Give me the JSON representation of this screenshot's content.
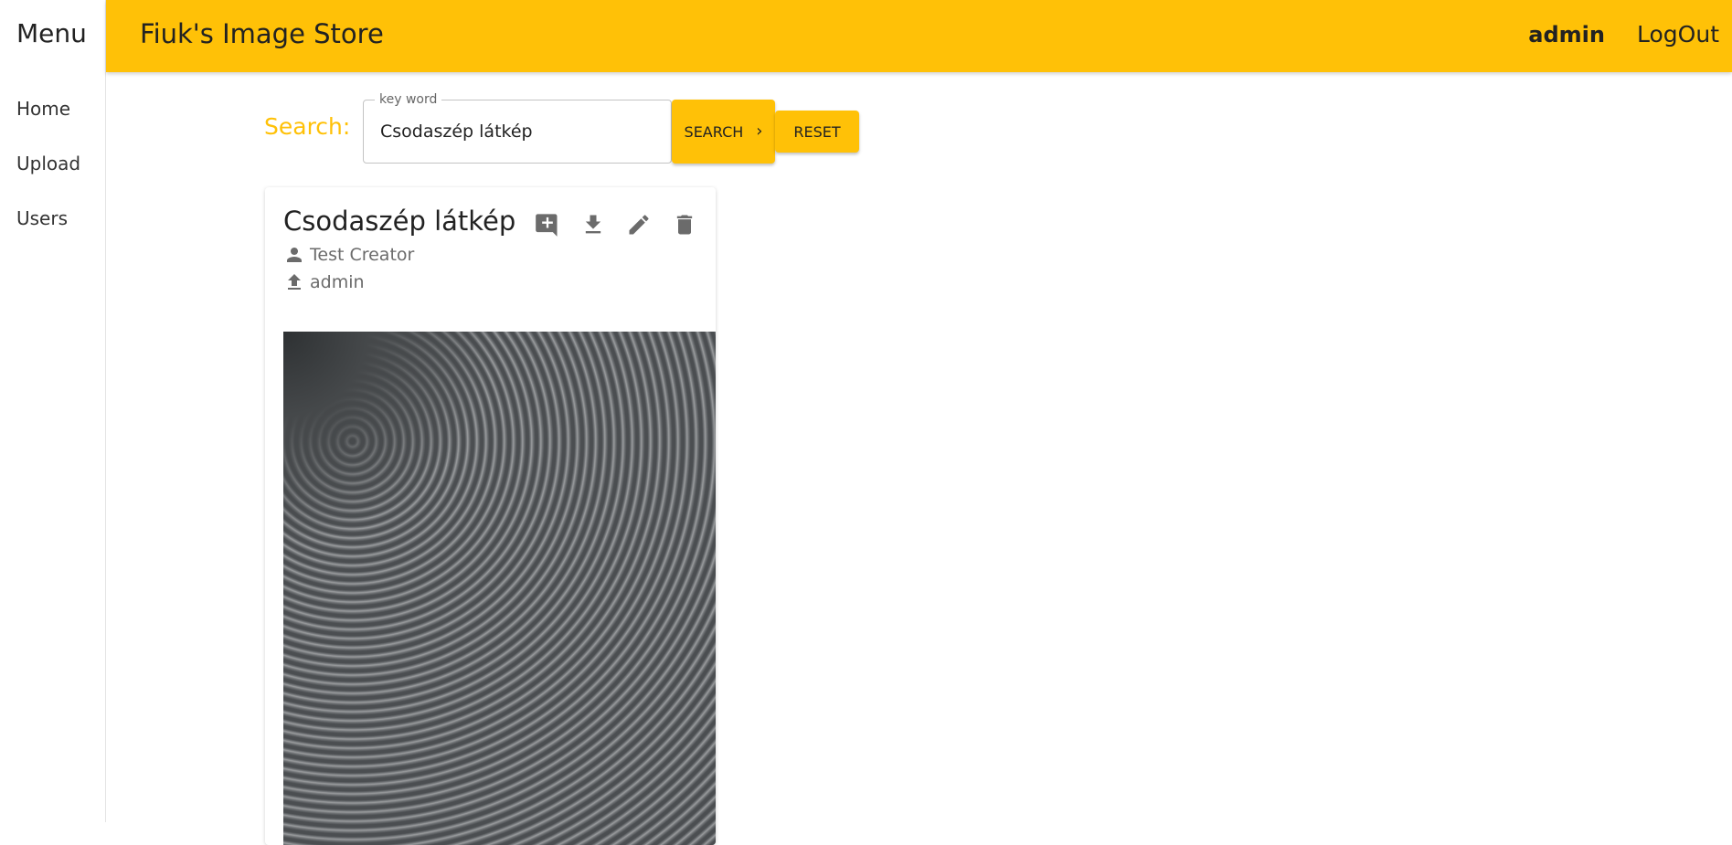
{
  "sidebar": {
    "title": "Menu",
    "items": [
      {
        "label": "Home"
      },
      {
        "label": "Upload"
      },
      {
        "label": "Users"
      }
    ]
  },
  "header": {
    "title": "Fiuk's Image Store",
    "username": "admin",
    "logout_label": "LogOut",
    "accent_color": "#ffc107"
  },
  "search": {
    "label": "Search:",
    "field_label": "key word",
    "value": "Csodaszép látkép",
    "search_button": "SEARCH",
    "reset_button": "RESET"
  },
  "card": {
    "title": "Csodaszép látkép",
    "creator": "Test Creator",
    "uploader": "admin",
    "actions": [
      "add-comment-icon",
      "download-icon",
      "edit-icon",
      "delete-icon"
    ]
  }
}
